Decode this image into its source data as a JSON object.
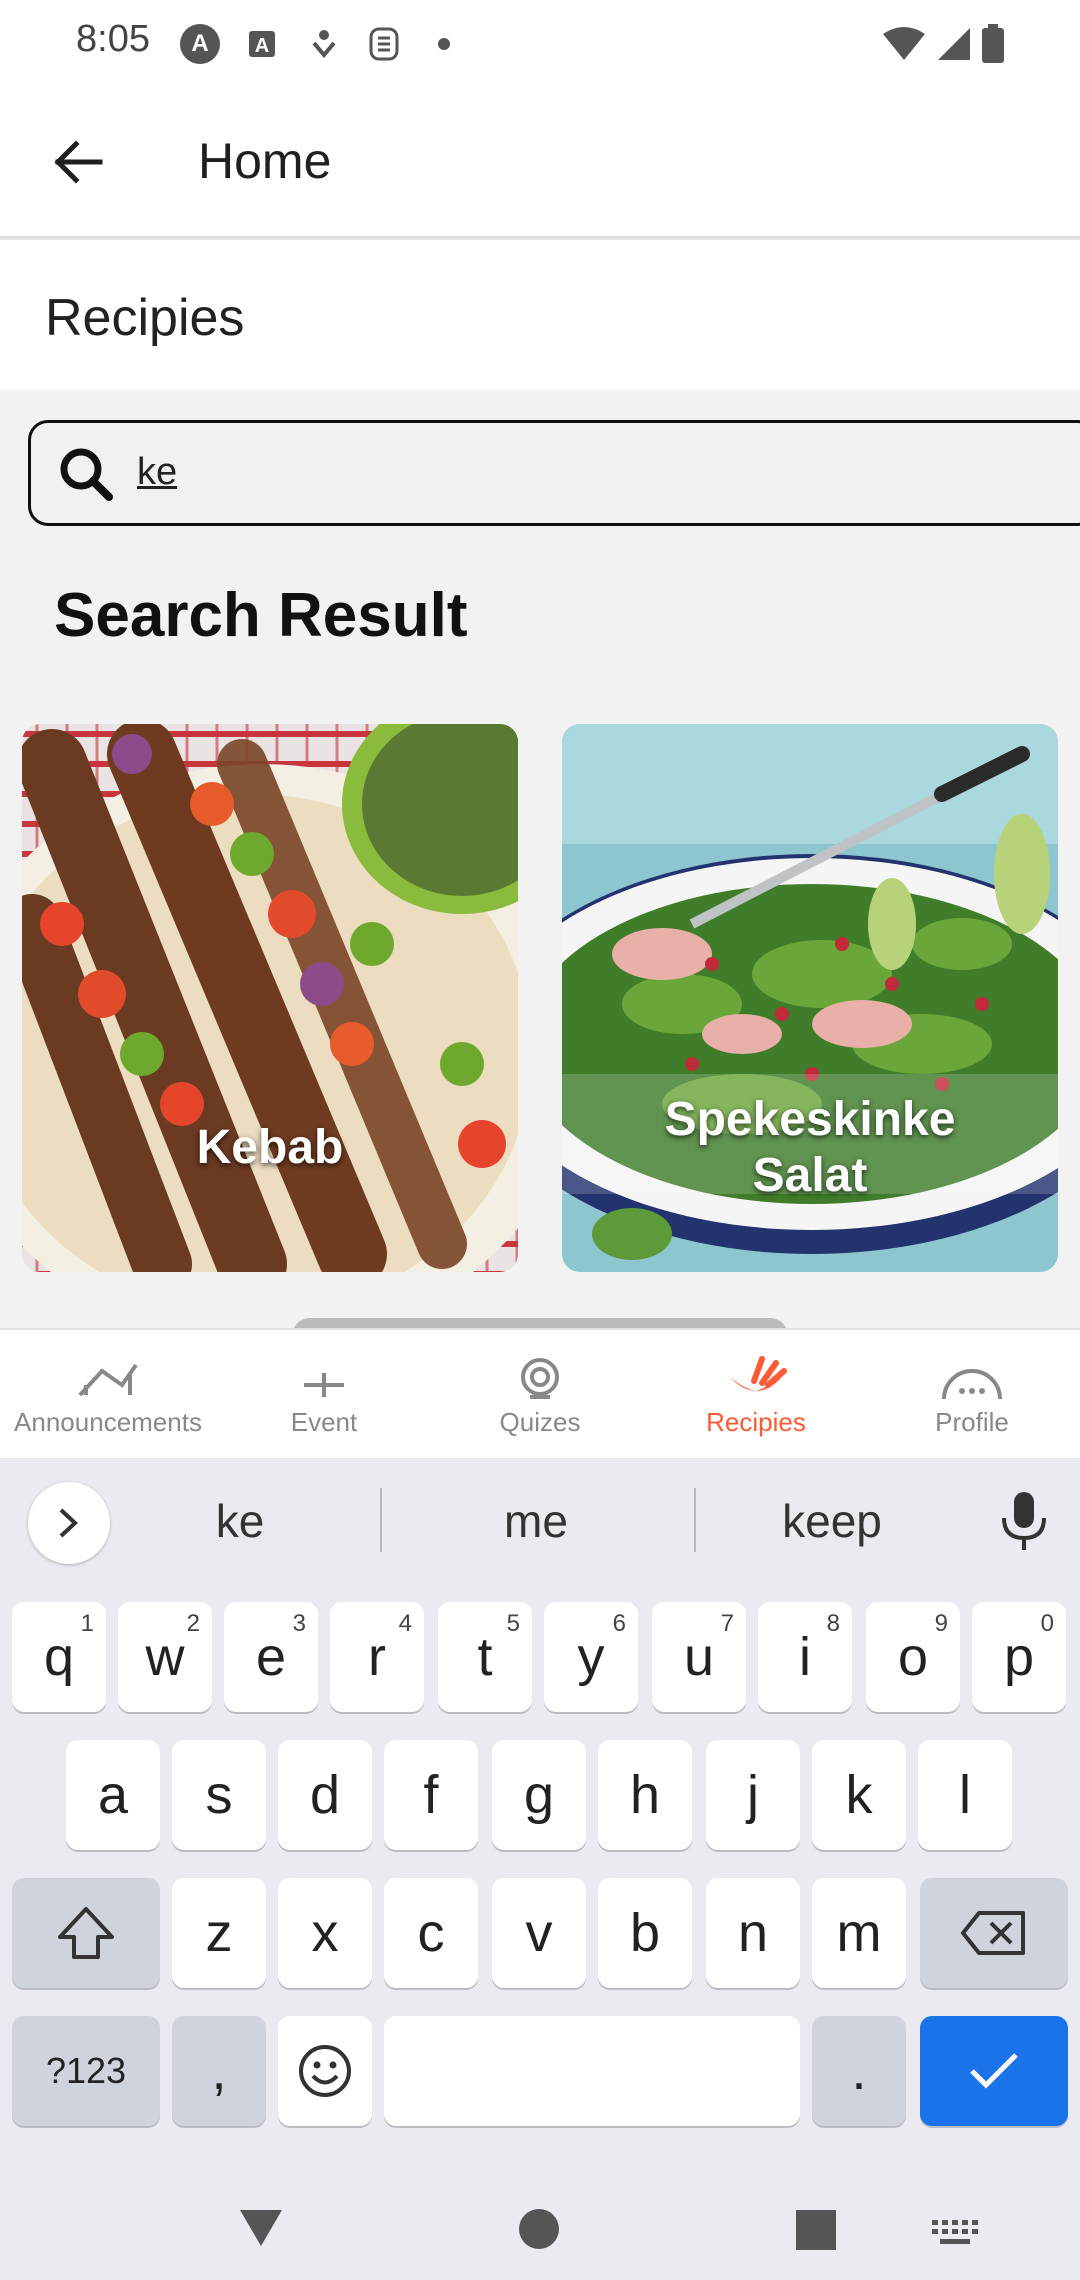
{
  "status_bar": {
    "time": "8:05",
    "icons": [
      "a-circle-icon",
      "a-box-icon",
      "download-icon",
      "notification-s-icon",
      "dot-icon"
    ],
    "right_icons": [
      "wifi-icon",
      "signal-icon",
      "battery-icon"
    ]
  },
  "app_bar": {
    "back_icon": "arrow-left-icon",
    "title": "Home"
  },
  "section": {
    "title": "Recipies"
  },
  "search": {
    "value": "ke",
    "icon": "search-icon"
  },
  "results": {
    "title": "Search Result",
    "cards": [
      {
        "label": "Kebab",
        "image": "kebab-skewers-photo"
      },
      {
        "label_line1": "Spekeskinke",
        "label_line2": "Salat",
        "image": "ham-salad-photo"
      }
    ]
  },
  "bottom_nav": {
    "items": [
      {
        "label": "Announcements",
        "icon": "house-icon",
        "active": false
      },
      {
        "label": "Event",
        "icon": "event-icon",
        "active": false
      },
      {
        "label": "Quizes",
        "icon": "quiz-icon",
        "active": false
      },
      {
        "label": "Recipies",
        "icon": "recipe-icon",
        "active": true
      },
      {
        "label": "Profile",
        "icon": "profile-icon",
        "active": false
      }
    ],
    "active_color": "#ff5a36"
  },
  "keyboard": {
    "suggestions": [
      "ke",
      "me",
      "keep"
    ],
    "row1": [
      "q",
      "w",
      "e",
      "r",
      "t",
      "y",
      "u",
      "i",
      "o",
      "p"
    ],
    "row1_hints": [
      "1",
      "2",
      "3",
      "4",
      "5",
      "6",
      "7",
      "8",
      "9",
      "0"
    ],
    "row2": [
      "a",
      "s",
      "d",
      "f",
      "g",
      "h",
      "j",
      "k",
      "l"
    ],
    "row3": [
      "z",
      "x",
      "c",
      "v",
      "b",
      "n",
      "m"
    ],
    "symbols_key": "?123",
    "comma_key": ",",
    "period_key": ".",
    "done_color": "#1a73e8"
  }
}
